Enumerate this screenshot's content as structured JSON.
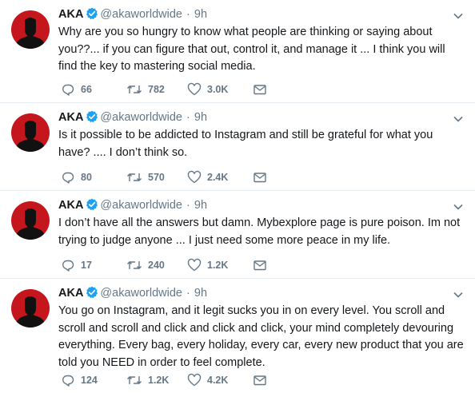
{
  "accent_color": "#1da1f2",
  "avatar_color": "#c4161c",
  "tweets": [
    {
      "name": "AKA",
      "handle": "@akaworldwide",
      "time": "9h",
      "text": "Why are you so hungry to know what people are thinking or saying about you??... if you can figure that out, control it, and manage it ... I think you will find the key to mastering social media.",
      "replies": "66",
      "retweets": "782",
      "likes": "3.0K"
    },
    {
      "name": "AKA",
      "handle": "@akaworldwide",
      "time": "9h",
      "text": "Is it possible to be addicted to Instagram and still be grateful for what you have? .... I don’t think so.",
      "replies": "80",
      "retweets": "570",
      "likes": "2.4K"
    },
    {
      "name": "AKA",
      "handle": "@akaworldwide",
      "time": "9h",
      "text": "I don’t have all the answers but damn. Mybexplore page is pure poison. Im not trying to judge anyone ... I just need some more peace in my life.",
      "replies": "17",
      "retweets": "240",
      "likes": "1.2K"
    },
    {
      "name": "AKA",
      "handle": "@akaworldwide",
      "time": "9h",
      "text": "You go on Instagram, and it legit sucks you in on every level. You scroll and scroll and scroll and click and click and click, your mind completely devouring everything. Every bag, every holiday, every car, every new product that you are told you NEED in order to feel complete.",
      "replies": "124",
      "retweets": "1.2K",
      "likes": "4.2K"
    }
  ]
}
